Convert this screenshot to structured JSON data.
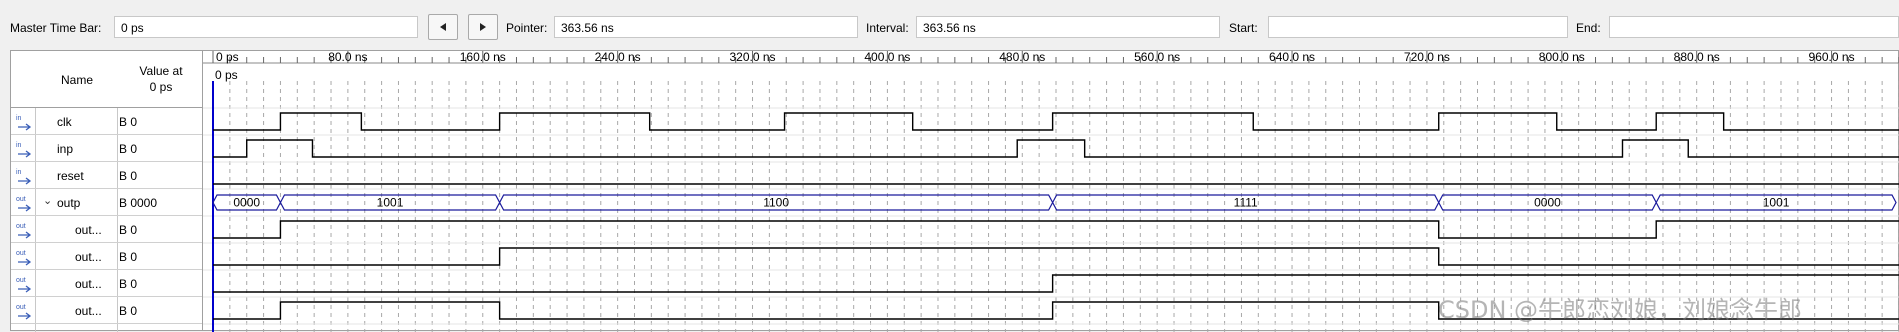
{
  "toolbar": {
    "master_time_bar_label": "Master Time Bar:",
    "master_time_bar_value": "0 ps",
    "prev_icon": "triangle-left-icon",
    "next_icon": "triangle-right-icon",
    "pointer_label": "Pointer:",
    "pointer_value": "363.56 ns",
    "interval_label": "Interval:",
    "interval_value": "363.56 ns",
    "start_label": "Start:",
    "start_value": "",
    "end_label": "End:",
    "end_value": ""
  },
  "signal_table": {
    "name_header": "Name",
    "value_header_line1": "Value at",
    "value_header_line2": "0 ps",
    "signals": [
      {
        "io": "in",
        "name": "clk",
        "value": "B 0",
        "expandable": false
      },
      {
        "io": "in",
        "name": "inp",
        "value": "B 0",
        "expandable": false
      },
      {
        "io": "in",
        "name": "reset",
        "value": "B 0",
        "expandable": false
      },
      {
        "io": "out",
        "name": "outp",
        "value": "B 0000",
        "expandable": true
      },
      {
        "io": "out",
        "name": "out...",
        "value": "B 0",
        "expandable": false
      },
      {
        "io": "out",
        "name": "out...",
        "value": "B 0",
        "expandable": false
      },
      {
        "io": "out",
        "name": "out...",
        "value": "B 0",
        "expandable": false
      },
      {
        "io": "out",
        "name": "out...",
        "value": "B 0",
        "expandable": false
      }
    ]
  },
  "timeline": {
    "ticks": [
      "0 ps",
      "80.0 ns",
      "160.0 ns",
      "240.0 ns",
      "320.0 ns",
      "400.0 ns",
      "480.0 ns",
      "560.0 ns",
      "640.0 ns",
      "720.0 ns",
      "800.0 ns",
      "880.0 ns",
      "960.0 ns"
    ],
    "cursor_label": "0 ps"
  },
  "waveforms": {
    "clk": [
      [
        0,
        0
      ],
      [
        40,
        1
      ],
      [
        88,
        0
      ],
      [
        170,
        1
      ],
      [
        259,
        0
      ],
      [
        339,
        1
      ],
      [
        415,
        0
      ],
      [
        498,
        1
      ],
      [
        617,
        0
      ],
      [
        727,
        1
      ],
      [
        797,
        0
      ],
      [
        856,
        1
      ],
      [
        896,
        0
      ]
    ],
    "inp": [
      [
        0,
        0
      ],
      [
        20,
        1
      ],
      [
        59,
        0
      ],
      [
        477,
        1
      ],
      [
        517,
        0
      ],
      [
        836,
        1
      ],
      [
        875,
        0
      ]
    ],
    "reset": [
      [
        0,
        0
      ]
    ],
    "outp_bus": [
      {
        "from": 0,
        "to": 40,
        "label": "0000"
      },
      {
        "from": 40,
        "to": 170,
        "label": "1001"
      },
      {
        "from": 170,
        "to": 498,
        "label": "1100"
      },
      {
        "from": 498,
        "to": 727,
        "label": "1111"
      },
      {
        "from": 727,
        "to": 856,
        "label": "0000"
      },
      {
        "from": 856,
        "to": 999,
        "label": "1001"
      }
    ],
    "out3": [
      [
        0,
        0
      ],
      [
        40,
        1
      ],
      [
        727,
        0
      ],
      [
        856,
        1
      ]
    ],
    "out2": [
      [
        0,
        0
      ],
      [
        170,
        1
      ],
      [
        727,
        0
      ]
    ],
    "out1": [
      [
        0,
        0
      ],
      [
        498,
        1
      ]
    ],
    "out0": [
      [
        0,
        0
      ],
      [
        40,
        1
      ],
      [
        170,
        0
      ],
      [
        498,
        1
      ],
      [
        727,
        0
      ]
    ]
  },
  "watermark": "CSDN @牛郎恋刘娘，刘娘念牛郎",
  "colors": {
    "wave": "#000000",
    "bus": "#1a1a9c",
    "cursor": "#0000cc",
    "grid": "#a8a8a8",
    "io_icon": "#3b5fb8"
  }
}
